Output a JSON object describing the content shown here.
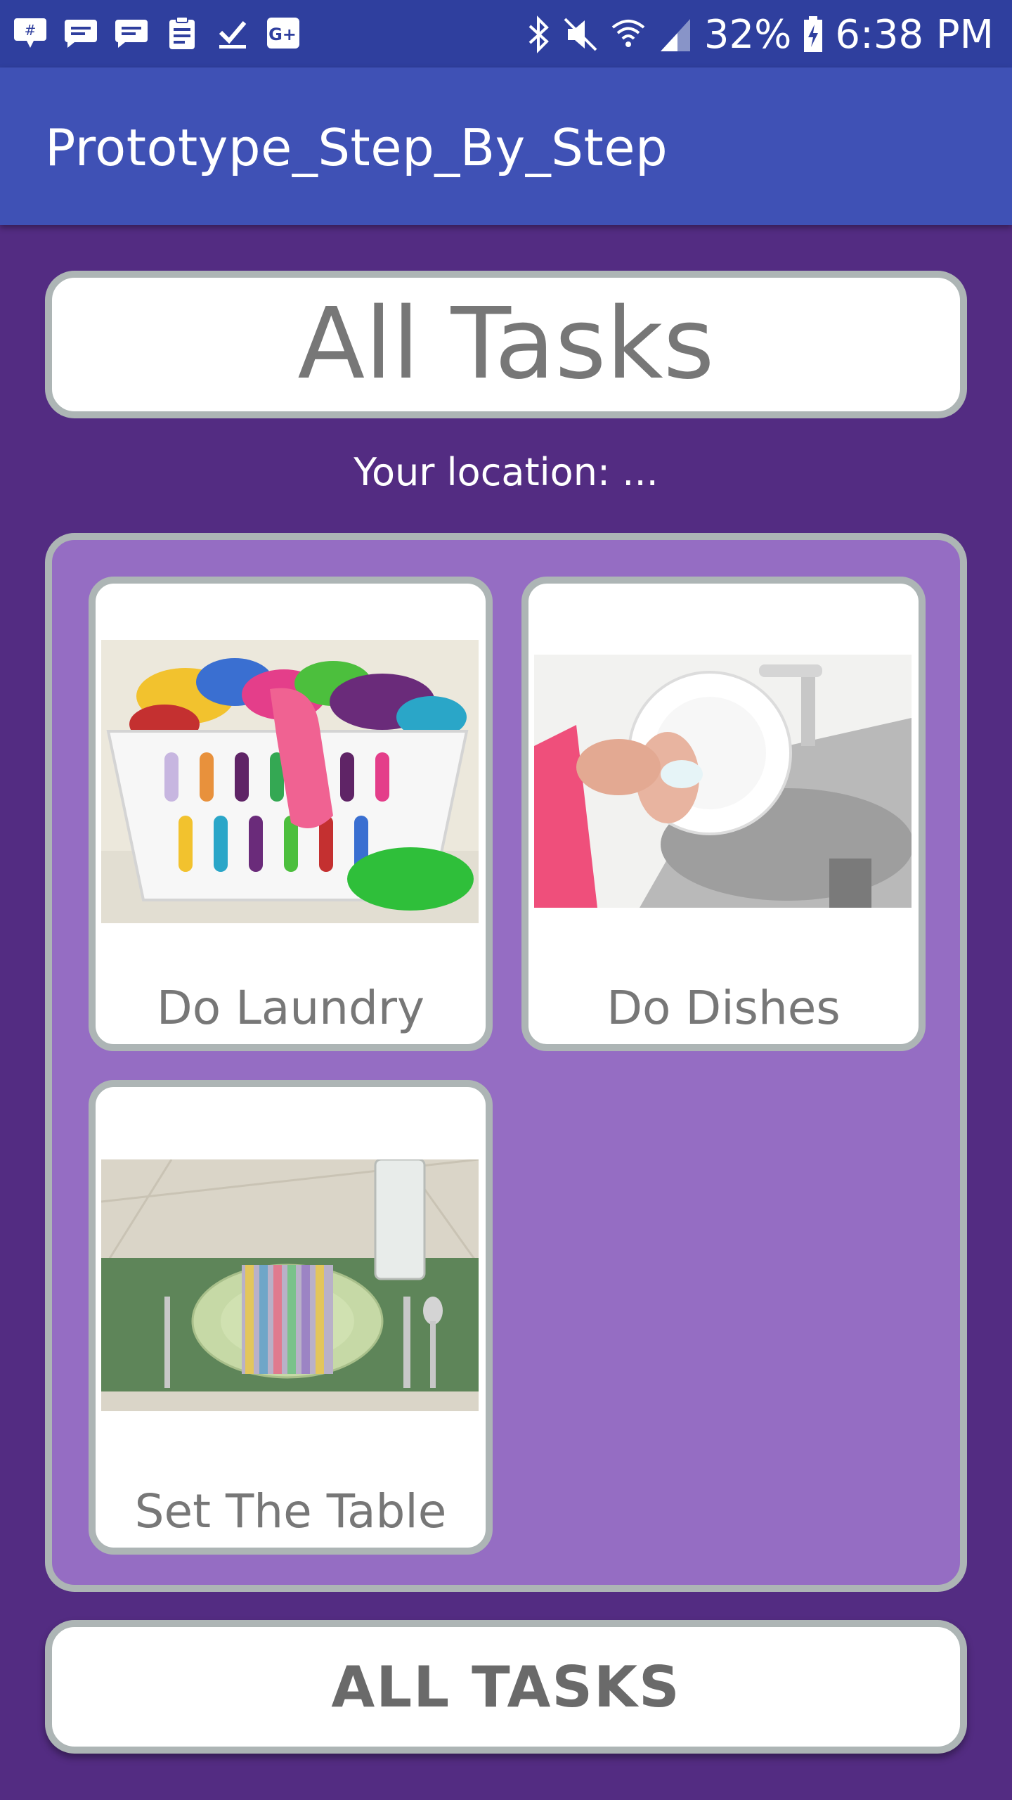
{
  "status_bar": {
    "battery": "32%",
    "time": "6:38 PM",
    "notification_icons": [
      "hangouts-icon",
      "messages-icon",
      "messages-icon",
      "clipboard-icon",
      "checkmark-icon",
      "google-plus-icon"
    ],
    "system_icons": [
      "bluetooth-icon",
      "mute-icon",
      "wifi-icon",
      "signal-icon",
      "battery-charging-icon"
    ]
  },
  "app_bar": {
    "title": "Prototype_Step_By_Step"
  },
  "header": {
    "title": "All Tasks"
  },
  "location": {
    "text": "Your location: ..."
  },
  "tasks": [
    {
      "label": "Do Laundry",
      "image": "laundry-basket-photo"
    },
    {
      "label": "Do Dishes",
      "image": "washing-dishes-photo"
    },
    {
      "label": "Set The Table",
      "image": "table-setting-photo"
    }
  ],
  "footer": {
    "button_label": "ALL TASKS"
  },
  "colors": {
    "status_bar": "#2f3f9e",
    "app_bar": "#3f51b5",
    "background": "#532c82",
    "panel": "#956dc3",
    "border": "#adb5b5",
    "label_text": "#777777"
  }
}
